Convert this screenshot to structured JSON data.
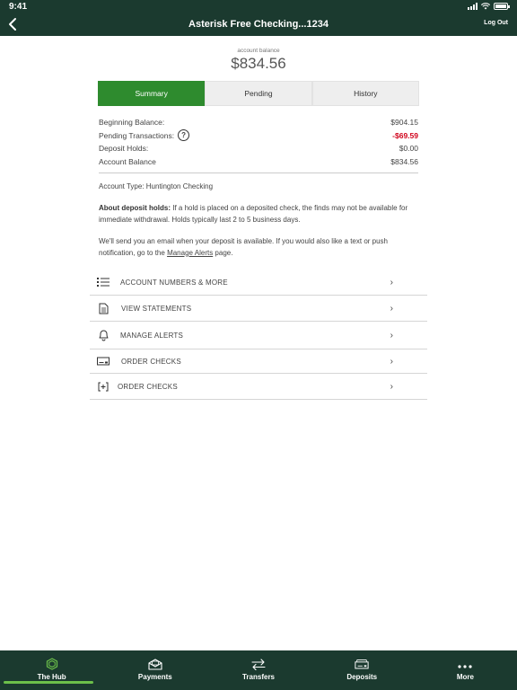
{
  "status_bar": {
    "time": "9:41"
  },
  "header": {
    "title": "Asterisk Free Checking...1234",
    "logout_label": "Log Out"
  },
  "balance": {
    "label": "account balance",
    "value": "$834.56"
  },
  "tabs": [
    {
      "label": "Summary",
      "active": true
    },
    {
      "label": "Pending",
      "active": false
    },
    {
      "label": "History",
      "active": false
    }
  ],
  "summary": {
    "beginning_label": "Beginning Balance:",
    "beginning_value": "$904.15",
    "pending_label": "Pending Transactions:",
    "pending_value": "-$69.59",
    "holds_label": "Deposit Holds:",
    "holds_value": "$0.00",
    "account_label": "Account Balance",
    "account_value": "$834.56"
  },
  "account_type": "Account Type: Huntington Checking",
  "deposit_holds": {
    "heading": "About deposit holds:",
    "text": " If a hold is placed on a deposited check, the finds may not be available for immediate withdrawal. Holds typically last 2 to 5 business days."
  },
  "email_note": {
    "text_before": "We'll send you an email when your deposit is available. If you would also like a text or push notification, go to the ",
    "link": "Manage Alerts",
    "text_after": " page."
  },
  "menu": [
    {
      "label": "ACCOUNT NUMBERS & MORE",
      "icon": "list-icon"
    },
    {
      "label": "VIEW STATEMENTS",
      "icon": "document-icon"
    },
    {
      "label": "MANAGE ALERTS",
      "icon": "bell-icon"
    },
    {
      "label": "ORDER CHECKS",
      "icon": "check-icon"
    },
    {
      "label": "ORDER CHECKS",
      "icon": "bracket-plus-icon"
    }
  ],
  "bottom_nav": [
    {
      "label": "The Hub",
      "icon": "hexagon-icon",
      "active": true
    },
    {
      "label": "Payments",
      "icon": "envelope-icon",
      "active": false
    },
    {
      "label": "Transfers",
      "icon": "transfer-arrows-icon",
      "active": false
    },
    {
      "label": "Deposits",
      "icon": "deposit-check-icon",
      "active": false
    },
    {
      "label": "More",
      "icon": "more-dots-icon",
      "active": false
    }
  ],
  "colors": {
    "header_bg": "#1b3a2f",
    "active_tab": "#2e8b2e",
    "negative": "#d0021b",
    "nav_indicator": "#6cc04a"
  }
}
